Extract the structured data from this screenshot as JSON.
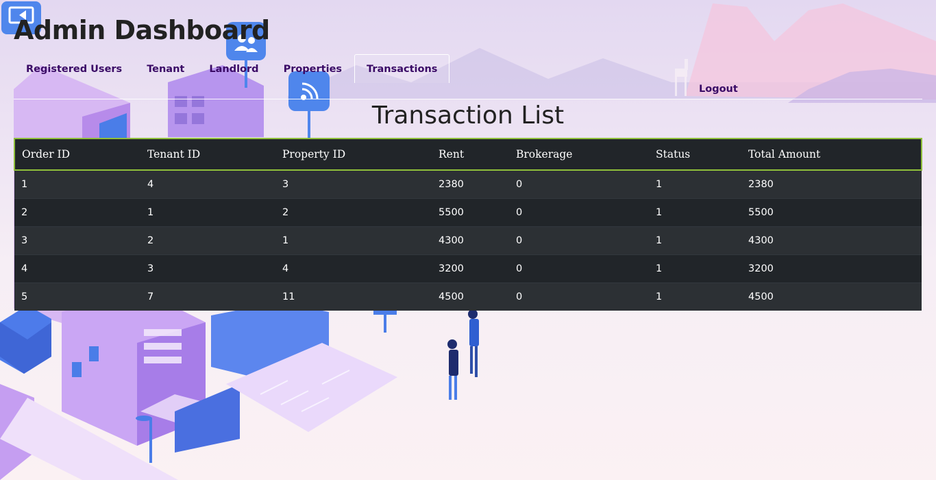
{
  "header": {
    "title": "Admin Dashboard"
  },
  "nav": {
    "items": [
      {
        "label": "Registered Users"
      },
      {
        "label": "Tenant"
      },
      {
        "label": "Landlord"
      },
      {
        "label": "Properties"
      },
      {
        "label": "Transactions",
        "active": true
      }
    ],
    "logout_label": "Logout"
  },
  "main": {
    "title": "Transaction List",
    "table": {
      "columns": [
        "Order ID",
        "Tenant ID",
        "Property ID",
        "Rent",
        "Brokerage",
        "Status",
        "Total Amount"
      ],
      "rows": [
        [
          "1",
          "4",
          "3",
          "2380",
          "0",
          "1",
          "2380"
        ],
        [
          "2",
          "1",
          "2",
          "5500",
          "0",
          "1",
          "5500"
        ],
        [
          "3",
          "2",
          "1",
          "4300",
          "0",
          "1",
          "4300"
        ],
        [
          "4",
          "3",
          "4",
          "3200",
          "0",
          "1",
          "3200"
        ],
        [
          "5",
          "7",
          "11",
          "4500",
          "0",
          "1",
          "4500"
        ]
      ]
    }
  },
  "colors": {
    "nav_text": "#3a0a66",
    "table_dark": "#212529",
    "table_stripe": "#2c3034",
    "header_border": "#8fbf3a"
  },
  "background_icons": [
    "video-icon",
    "users-icon",
    "wifi-icon"
  ]
}
